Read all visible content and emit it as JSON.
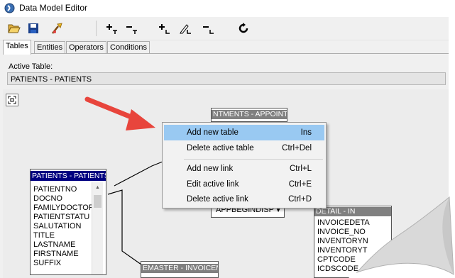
{
  "window": {
    "title": "Data Model Editor"
  },
  "toolbar": {
    "buttons": [
      {
        "name": "open-icon"
      },
      {
        "name": "save-icon"
      },
      {
        "name": "clear-icon"
      },
      {
        "name": "add-table-icon"
      },
      {
        "name": "remove-table-icon"
      },
      {
        "name": "add-link-icon"
      },
      {
        "name": "edit-link-icon"
      },
      {
        "name": "remove-link-icon"
      },
      {
        "name": "refresh-icon"
      }
    ]
  },
  "tabs": [
    "Tables",
    "Entities",
    "Operators",
    "Conditions"
  ],
  "active_table": {
    "label": "Active Table:",
    "value": "PATIENTS - PATIENTS"
  },
  "diagram": {
    "appointments_title": "NTMENTS - APPOINT",
    "appointments_field": "APPBEGINDISP",
    "patients_title": "PATIENTS - PATIENTS",
    "patients_fields": [
      "PATIENTNO",
      "DOCNO",
      "FAMILYDOCTOR",
      "PATIENTSTATU",
      "SALUTATION",
      "TITLE",
      "LASTNAME",
      "FIRSTNAME",
      "SUFFIX"
    ],
    "invoicedetail_title": "DETAIL - IN",
    "invoicedetail_fields": [
      "INVOICEDETA",
      "INVOICE_NO",
      "INVENTORYN",
      "INVENTORYT",
      "CPTCODE",
      "ICDSCODE"
    ],
    "invoicemaster_title": "EMASTER - INVOICEM"
  },
  "context_menu": {
    "items": [
      {
        "label": "Add new table",
        "shortcut": "Ins"
      },
      {
        "label": "Delete active table",
        "shortcut": "Ctrl+Del"
      },
      {
        "label": "Add new link",
        "shortcut": "Ctrl+L"
      },
      {
        "label": "Edit active link",
        "shortcut": "Ctrl+E"
      },
      {
        "label": "Delete active link",
        "shortcut": "Ctrl+D"
      }
    ]
  },
  "colors": {
    "arrow": "#e8453c",
    "table_header_active": "#000080",
    "table_header_inactive": "#808080",
    "menu_highlight": "#99c9f2"
  }
}
